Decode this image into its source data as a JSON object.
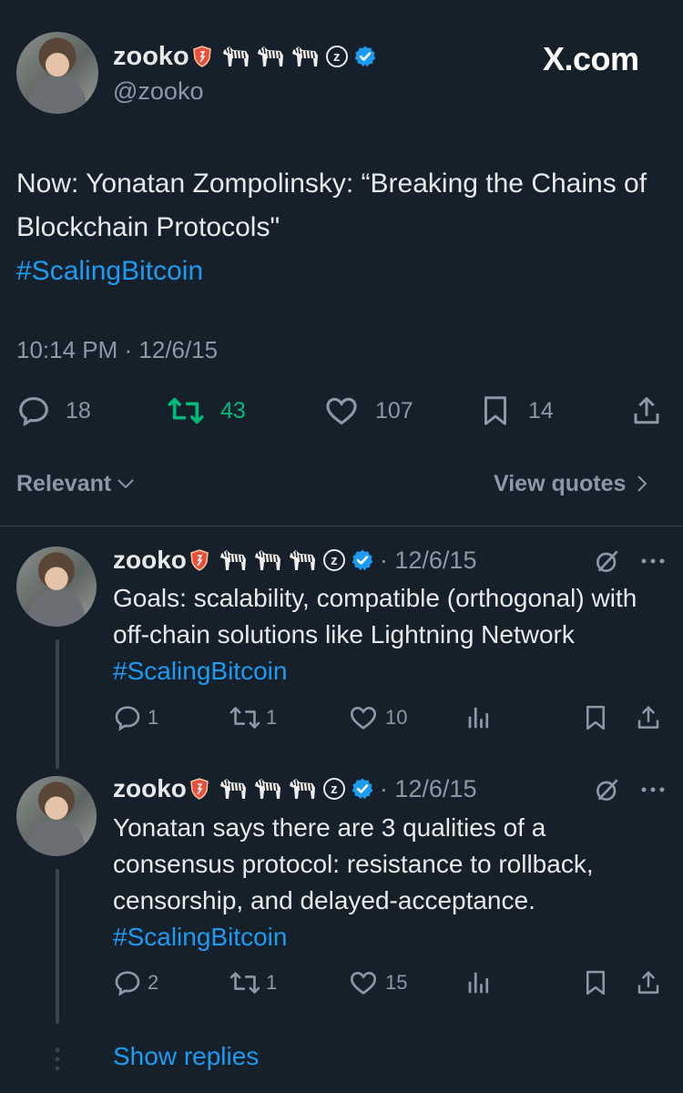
{
  "header": {
    "name": "zooko",
    "handle": "@zooko",
    "brand": "X.com"
  },
  "main_tweet": {
    "text_part1": "Now: Yonatan Zompolinsky: “Breaking the Chains of Blockchain Protocols\"",
    "hashtag": "#ScalingBitcoin",
    "timestamp": "10:14 PM · 12/6/15",
    "replies": "18",
    "retweets": "43",
    "likes": "107",
    "bookmarks": "14"
  },
  "sort": {
    "relevant": "Relevant",
    "view_quotes": "View quotes"
  },
  "replies": [
    {
      "name": "zooko",
      "date": "· 12/6/15",
      "text": "Goals: scalability, compatible (orthogonal) with off-chain solutions like Lightning Network",
      "hashtag": "#ScalingBitcoin",
      "replies": "1",
      "retweets": "1",
      "likes": "10"
    },
    {
      "name": "zooko",
      "date": "· 12/6/15",
      "text": "Yonatan says there are 3 qualities of a consensus protocol: resistance to rollback, censorship, and delayed-acceptance.",
      "hashtag": "#ScalingBitcoin",
      "replies": "2",
      "retweets": "1",
      "likes": "15"
    }
  ],
  "show_replies": "Show replies",
  "colors": {
    "background": "#15202b",
    "link": "#1d9bf0",
    "retweet_active": "#00ba7c",
    "muted": "#8b98a5"
  }
}
